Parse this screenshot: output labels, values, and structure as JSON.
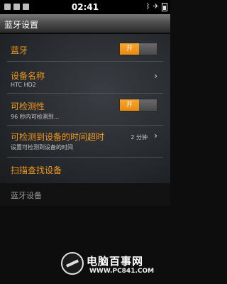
{
  "status_bar": {
    "time": "02:41",
    "left_icons": [
      "notification-icon",
      "usb-icon",
      "sd-icon"
    ],
    "right_icons": [
      "bluetooth-icon",
      "airplane-icon",
      "battery-icon"
    ]
  },
  "title_bar": {
    "title": "蓝牙设置"
  },
  "settings": {
    "bluetooth": {
      "label": "蓝牙",
      "toggle_on": "开"
    },
    "device_name": {
      "label": "设备名称",
      "value": "HTC HD2"
    },
    "discoverable": {
      "label": "可检测性",
      "sub": "96 秒内可检测到...",
      "toggle_on": "开"
    },
    "timeout": {
      "label": "可检测到设备的时间超时",
      "sub": "设置可检测到设备的时间",
      "value": "2 分钟"
    },
    "scan": {
      "label": "扫描查找设备"
    }
  },
  "section": {
    "label": "蓝牙设备"
  },
  "watermark": {
    "brand": "电脑百事网",
    "url": "WWW.PC841.COM"
  },
  "colors": {
    "accent": "#f29a1d",
    "toggle_on": "#f39a20"
  }
}
